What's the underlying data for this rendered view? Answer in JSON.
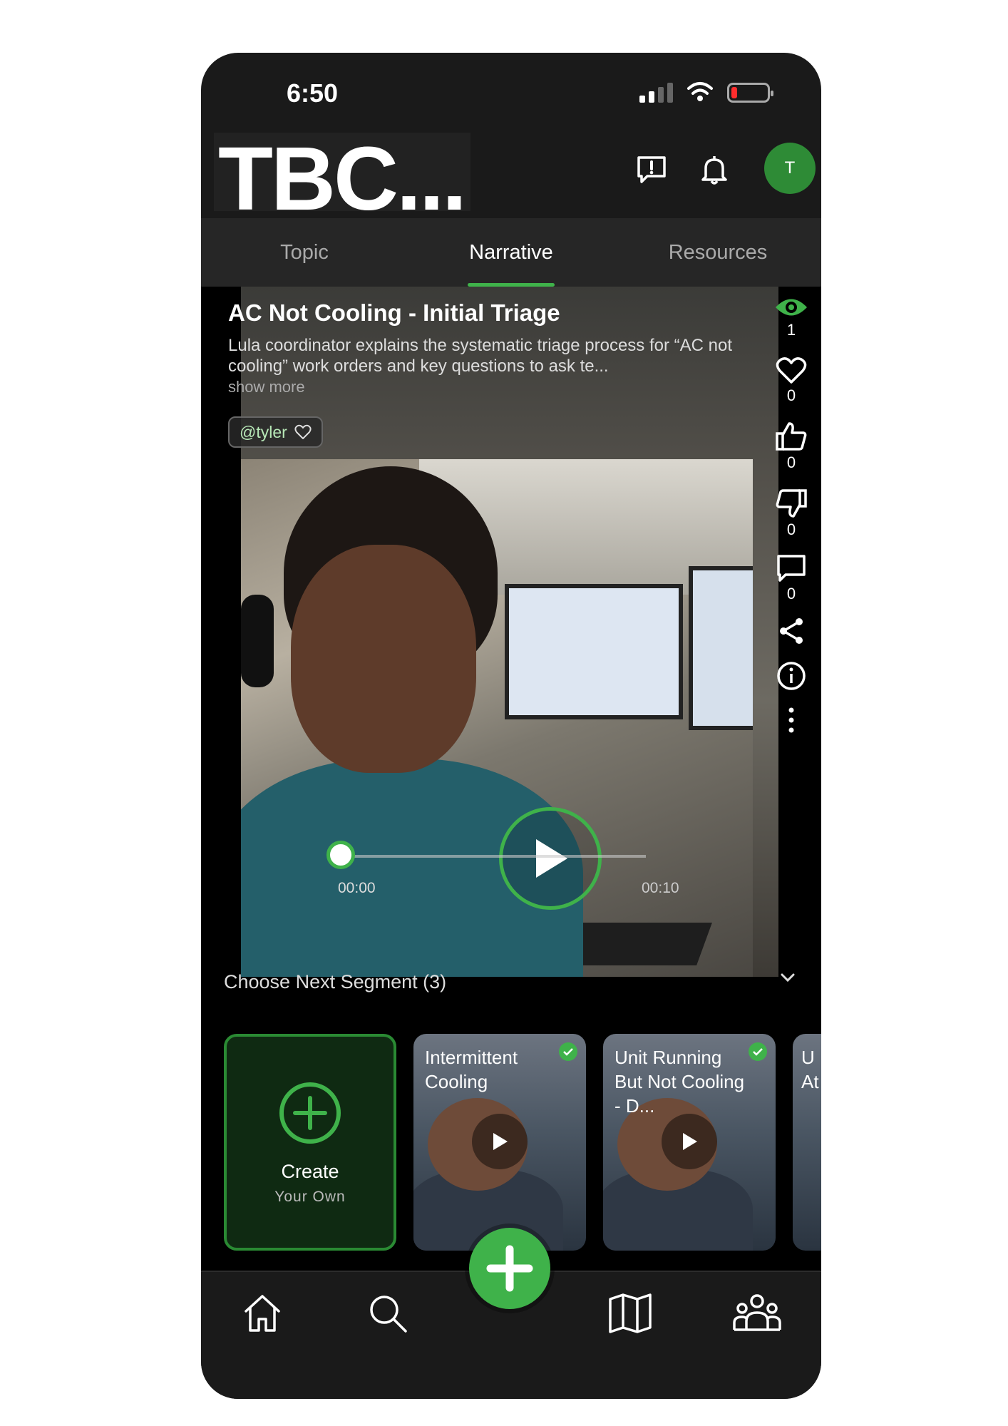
{
  "status_bar": {
    "time": "6:50"
  },
  "header": {
    "brand": "TBC...",
    "avatar_initial": "T"
  },
  "tabs": [
    {
      "label": "Topic",
      "active": false
    },
    {
      "label": "Narrative",
      "active": true
    },
    {
      "label": "Resources",
      "active": false
    }
  ],
  "segment": {
    "title": "AC Not Cooling - Initial Triage",
    "description": "Lula coordinator explains the systematic triage process for “AC not cooling” work orders and key questions to ask te...",
    "show_more": "show more",
    "author": "@tyler",
    "time_current": "00:00",
    "time_total": "00:10",
    "progress": 0
  },
  "side_actions": {
    "views": "1",
    "likes": "0",
    "thumbs_up": "0",
    "thumbs_down": "0",
    "comments": "0"
  },
  "next_segments": {
    "heading": "Choose Next Segment (3)",
    "create": {
      "line1": "Create",
      "line2": "Your Own"
    },
    "cards": [
      {
        "title": "Intermittent Cooling",
        "watched": true
      },
      {
        "title": "Unit Running But Not Cooling - D...",
        "watched": true
      },
      {
        "title": "U At",
        "watched": false
      }
    ]
  },
  "colors": {
    "accent": "#3fb24a",
    "background": "#1a1a1a"
  }
}
